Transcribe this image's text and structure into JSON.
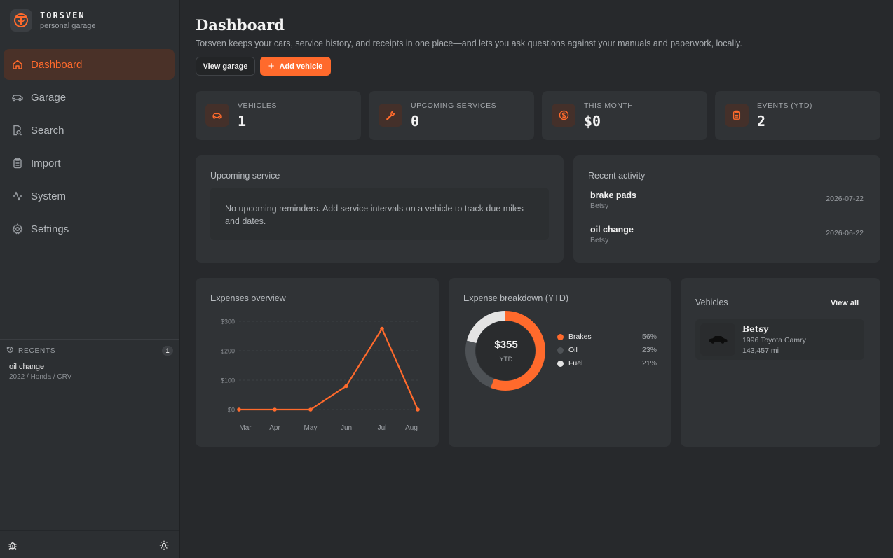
{
  "brand": {
    "name": "TORSVEN",
    "subtitle": "personal garage"
  },
  "nav": [
    {
      "label": "Dashboard",
      "icon": "home-icon",
      "active": true
    },
    {
      "label": "Garage",
      "icon": "car-icon"
    },
    {
      "label": "Search",
      "icon": "search-icon"
    },
    {
      "label": "Import",
      "icon": "clipboard-icon"
    },
    {
      "label": "System",
      "icon": "activity-icon"
    },
    {
      "label": "Settings",
      "icon": "gear-icon"
    }
  ],
  "recents": {
    "title": "RECENTS",
    "count": "1",
    "items": [
      {
        "title": "oil change",
        "subtitle": "2022 / Honda / CRV"
      }
    ]
  },
  "header": {
    "title": "Dashboard",
    "description": "Torsven keeps your cars, service history, and receipts in one place—and lets you ask questions against your manuals and paperwork, locally.",
    "view_garage": "View garage",
    "add_vehicle": "Add vehicle"
  },
  "stats": [
    {
      "label": "VEHICLES",
      "value": "1",
      "icon": "car-icon"
    },
    {
      "label": "UPCOMING SERVICES",
      "value": "0",
      "icon": "wrench-icon"
    },
    {
      "label": "THIS MONTH",
      "value": "$0",
      "icon": "dollar-icon"
    },
    {
      "label": "EVENTS (YTD)",
      "value": "2",
      "icon": "clipboard-icon"
    }
  ],
  "upcoming": {
    "title": "Upcoming service",
    "empty": "No upcoming reminders. Add service intervals on a vehicle to track due miles and dates."
  },
  "activity": {
    "title": "Recent activity",
    "items": [
      {
        "title": "brake pads",
        "subtitle": "Betsy",
        "date": "2026-07-22"
      },
      {
        "title": "oil change",
        "subtitle": "Betsy",
        "date": "2026-06-22"
      }
    ]
  },
  "expenses_title": "Expenses overview",
  "breakdown": {
    "title": "Expense breakdown (YTD)",
    "total": "$355",
    "total_label": "YTD"
  },
  "vehicles": {
    "title": "Vehicles",
    "view_all": "View all",
    "items": [
      {
        "name": "Betsy",
        "model": "1996 Toyota Camry",
        "miles": "143,457 mi"
      }
    ]
  },
  "colors": {
    "accent": "#ff6a2c",
    "oil": "#4e5256",
    "fuel": "#e4e4e4"
  },
  "chart_data": [
    {
      "type": "line",
      "categories": [
        "Mar",
        "Apr",
        "May",
        "Jun",
        "Jul",
        "Aug"
      ],
      "values": [
        0,
        0,
        0,
        80,
        275,
        0
      ],
      "ylim": [
        0,
        300
      ],
      "yticks": [
        0,
        100,
        200,
        300
      ],
      "ytick_labels": [
        "$0",
        "$100",
        "$200",
        "$300"
      ],
      "grid": true
    },
    {
      "type": "pie",
      "categories": [
        "Brakes",
        "Oil",
        "Fuel"
      ],
      "values": [
        56,
        23,
        21
      ],
      "labels": [
        "56%",
        "23%",
        "21%"
      ],
      "colors": [
        "#ff6a2c",
        "#4e5256",
        "#e4e4e4"
      ],
      "legend": "right"
    }
  ]
}
